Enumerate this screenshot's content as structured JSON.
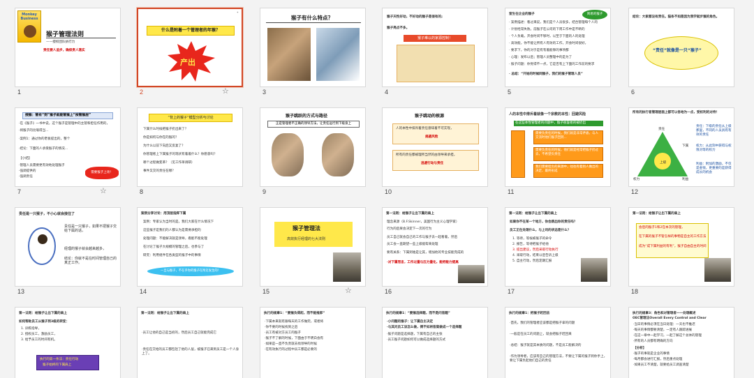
{
  "selected_slide": 2,
  "slides": [
    {
      "num": "1",
      "title": "猴子管理法则",
      "subtitle": "——授权团队执行力",
      "note": "责任要人追步，确保责人落实",
      "logo_text": "Monkey Business"
    },
    {
      "num": "2",
      "title": "什么是附着一个管理者的年猴？",
      "label": "产出"
    },
    {
      "num": "3",
      "title": "猴子有什么特点？"
    },
    {
      "num": "4",
      "lines": [
        "猴子天性好动，不好动的猴子是很有的;",
        "猴子亮点不多。"
      ],
      "banner": "猴子难以的家源控制！"
    },
    {
      "num": "5",
      "heading": "室生在企业的猴子",
      "badge": "简易的猴子",
      "lines": [
        "· 案例描述：看过来说，我们是个人员很多，结合管理每个人的",
        "· 计划经常失败。前猴子在公司的下周工作中是不断的",
        "· 个人负载，开会时间不够时，以至于下面的人的处理",
        "· 高效能，你不能让所有人有效的工作，开会时间很好，",
        "· 要求下，你的对于是有有着能够的事项都",
        "· 心理：发布以后；管理人员整理中的是为了",
        "· 猴子问题：你觉得不一点，它是否有上下面的工作前的要求",
        "· 总结：“开始的时候同猴子，我们的猴子管理人员”"
      ]
    },
    {
      "num": "6",
      "intro": "结论：大家都没有责任。猫条不如是因为我学就步猴的角色。",
      "bubble": "“责任”就像是一只“猴子”"
    },
    {
      "num": "7",
      "box": "授猴：管有“到”猴子就能管猴上“按管猴层”",
      "lines": [
        "·在《猴子》一书中说，这个猴子是管理中的主管和担任作用的，",
        "·将猴子的比喻得当...",
        "·案例1：通过你的老板提出的，整个",
        "·结论：下面的人承受猴子的情况...",
        "【小结】",
        "·管理人员需要更有效地处理猴子",
        "·强调提供的",
        "·强调责任"
      ],
      "badge": "需要猴子上场！"
    },
    {
      "num": "8",
      "box": "“背上的猴子”模型分析与讨论",
      "items": [
        "下属什么时候把猴子扔出来了？",
        "你是如何与你在的猴的？",
        "为什么以前下向后又反复了？",
        "你管理者上下属猴子的现状有着着什么？你愿意吗？",
        "哪个过程做变革？（见工作单调研）",
        "事件又交的责任在哪？"
      ]
    },
    {
      "num": "9",
      "title": "猴子跳跃的方式与路径",
      "box": "正是管理者不正确的领导方法，让责任运行到下级身上"
    },
    {
      "num": "10",
      "title": "猴子跳动的根源",
      "lines": [
        "人的本性中排斥着责任意味着不可实现，",
        "规避风险",
        "所有的责任都被理所当然的由领导来承担，",
        "逃避行动与责任"
      ]
    },
    {
      "num": "11",
      "title": "人的本性中排斥着就像一个宗教的本性：回避风险",
      "green": "在这些本性管理者的问题中，猴子很容易的被扔出",
      "orange": [
        "需要负责任的时候，我们就是非常矛盾，与人交流时他们猴子回到...",
        "需要负责任的时候，他们就是经常把猴子扔过去，不希望负责任",
        "我们需要担负的来源中，往往有着别人做出的决定、最终形成"
      ]
    },
    {
      "num": "12",
      "title": "所有的执行者管理层面上都可以各地为一点，受权利的对待！",
      "labels": [
        "责任",
        "下属",
        "上级",
        "权力",
        "利益"
      ],
      "side": [
        "责任：下级的责任从上级那里，不同的人员具有有效的责任",
        "权力：从此刻中获得与权限对等的权力",
        "利益：附加的激励，不仅是金钱，更重要的是获得成长的机会"
      ]
    },
    {
      "num": "13",
      "title": "责任是一只猴子，不小心就会接住了",
      "side": [
        "责任是一只猴子，如果不把猴子交给下属的话，",
        "经理的猴子就会越来越多，",
        "结论：你就不是在时间管理自己的真正工作。"
      ]
    },
    {
      "num": "14",
      "title": "案例分享讨论：用顶层指挥下属",
      "lines": [
        "案例：专家认为当时的是，我们大家在什么情况下",
        "这些猴子是我们的人都认为是需要承担的",
        "处理问题：不能解决就是领导，看能不能处理",
        "在讨论了猴子大规模的管理之后，也参与了",
        "研究：利用组件在各类型的猴子中的事情"
      ],
      "banner": "一旦与猴子，不在乎你的猴子在附近发生的！"
    },
    {
      "num": "15",
      "title": "猴子管理法",
      "subtitle": "高效执行经理的七大法则"
    },
    {
      "num": "16",
      "title": "第一法则：给猴子让出下属的肩上",
      "lines": [
        "理念来源（B.F.Skinner，美国行为主义心理学家）",
        "行为的后果会决定下一次的行为",
        "员工自己就会自己的工作与猴子去一起看着，然后",
        "员工会一直期望一些上级能帮来处理",
        "要有关系：下属到谁是让其，增加他的专业技能完成的",
        "·对下属而言，工作过量与压力量化，能把能力提高"
      ]
    },
    {
      "num": "17",
      "title": "第一法则：给猴子让出下属的肩上",
      "lines": [
        "如果你不在某一个地方，你会跳出你的责任吗？",
        "员工正在处理什么，与上司的状态是什么？",
        "1. 等待，等候被猴子的命令",
        "2. 报告，等待把猴子给他",
        "3. 提出建议，然后采取行动执行",
        "4. 采取行动，结束以后告诉上级",
        "5. 自主行动，然后定期汇报"
      ]
    },
    {
      "num": "18",
      "title": "第一法则：给猴子让出下属的肩上",
      "box": [
        "会后的猴子1和2在本次的管理，",
        "在下属的猴子不管怎样的事物是自主的工作方法",
        "成为“成下属利益的有利”，猴子自由自主的时间"
      ]
    },
    {
      "num": "19",
      "title": "第一法则：给猴子让出下属的肩上",
      "intro": "如何帮助员工从猴子到3级的转变：",
      "items": [
        "1. 训练指导，",
        "2. 授权员工，激励员工，",
        "3. 给予员工的时间有机。"
      ],
      "banner": [
        "执行的第一条法：责任行动",
        "猴子始终的下属肩上"
      ]
    },
    {
      "num": "20",
      "title": "第一法则：给猴子让出下属的肩上",
      "lines": [
        "·员工让他的自己是当初的，然后员工自己就能完成它",
        "·责任在交给的员工都包括了他的人层，被猴子已来到员工是一个人身上了。"
      ]
    },
    {
      "num": "21",
      "title": "执行的规章1：“要猴负得起，而不能推卸”",
      "lines": [
        "·下属本来就有跟每天的工作做完，或者将",
        "·你不要的时候找到之后",
        "·员工有被对方员工的猴子",
        "·猴子不了解的时候，下面由于不明白会有",
        "·如果是一直不负责就去找领导的时候",
        "·在有效执行的过程中员工都是必要的"
      ]
    },
    {
      "num": "22",
      "title": "执行的规章1：“要猴选择题，而不是问答题”",
      "lines": [
        "·小问题的猴子：让下属自主决定",
        "·与其问员工该怎么做，倒不如将答案做成一个选择题",
        "·猴子问题是选择题，下属有自己的主张",
        "·员工猴子问题如何可以做成选择题的方式"
      ]
    },
    {
      "num": "23",
      "title": "执行的规章1：把猴子赶回去",
      "lines": [
        "·首先，我们的管理者应该都是把猴子拿的问题",
        "·一般是在员工的问题上，就会把猴子赶回来",
        "·总结：猴子就是其本质的问题，不是员工能解决的",
        "·作为领导者，应该有自己的管理方法，不要让下属的猴子到你手上，要让下属负起他们自己的责任"
      ]
    },
    {
      "num": "24",
      "title": "执行的规章3：角色和对管理者一一处理概述",
      "subtitle": "OEC管理法Overall Every Control and Clear",
      "lines": [
        "·当日的事情必须在当日处理：一天也不推迟",
        "·每天的事情都要清楚，一定有人跟踪进展",
        "·在这一章中一起学习，一起了解这个总体的管理",
        "·所有的人员都有明确的方向",
        "【分析】",
        "·猴子的事就是企业的事情",
        "·每月都会进行汇报，然后重点处理",
        "·如果员工不清楚，就要给员工调查清楚"
      ]
    }
  ]
}
